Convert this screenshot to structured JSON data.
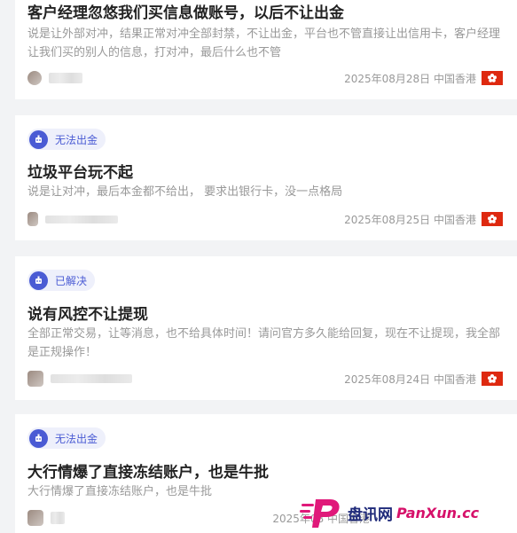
{
  "posts": [
    {
      "title": "客户经理忽悠我们买信息做账号，以后不让出金",
      "desc": "说是让外部对冲，结果正常对冲全部封禁，不让出金，平台也不管直接让出信用卡，客户经理让我们买的别人的信息，打对冲，最后什么也不管",
      "date": "2025年08月28日",
      "region": "中国香港"
    },
    {
      "tag": "无法出金",
      "title": "垃圾平台玩不起",
      "desc": "说是让对冲，最后本金都不给出， 要求出银行卡，没一点格局",
      "date": "2025年08月25日",
      "region": "中国香港"
    },
    {
      "tag": "已解决",
      "title": "说有风控不让提现",
      "desc": "全部正常交易，让等消息，也不给具体时间！请问官方多久能给回复，现在不让提现，我全部是正规操作！",
      "date": "2025年08月24日",
      "region": "中国香港"
    },
    {
      "tag": "无法出金",
      "title": "大行情爆了直接冻结账户，也是牛批",
      "desc": "大行情爆了直接冻结账户，也是牛批",
      "date": "2025年08",
      "region": "中国香港"
    }
  ],
  "watermark": {
    "cn": "盘讯网",
    "en": "PanXun.cc"
  },
  "colors": {
    "accent": "#4a5bd4",
    "flag": "#de2910",
    "watermark_pink": "#d6116a"
  }
}
